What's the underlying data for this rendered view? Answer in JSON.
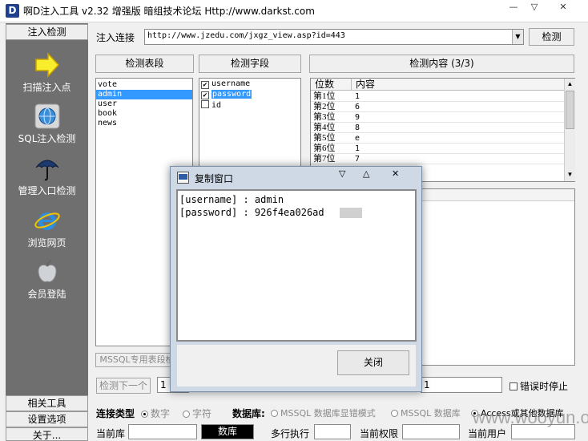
{
  "window": {
    "title": "啊D注入工具 v2.32 增强版 暗组技术论坛 Http://www.darkst.com",
    "icon_letter": "D",
    "minimize": "—",
    "restore": "▽",
    "close": "✕"
  },
  "sidebar": {
    "header": "注入检测",
    "items": [
      {
        "label": "扫描注入点",
        "icon": "arrow-icon"
      },
      {
        "label": "SQL注入检测",
        "icon": "globe-icon"
      },
      {
        "label": "管理入口检测",
        "icon": "umbrella-icon"
      },
      {
        "label": "浏览网页",
        "icon": "ie-icon"
      },
      {
        "label": "会员登陆",
        "icon": "apple-icon"
      }
    ],
    "bottom": [
      "相关工具",
      "设置选项",
      "关于..."
    ]
  },
  "toolbar": {
    "url_label": "注入连接",
    "url_value": "http://www.jzedu.com/jxgz_view.asp?id=443",
    "detect_button": "检测"
  },
  "tables_panel": {
    "button": "检测表段",
    "items": [
      "vote",
      "admin",
      "user",
      "book",
      "news"
    ],
    "selected": "admin"
  },
  "fields_panel": {
    "button": "检测字段",
    "items": [
      {
        "name": "username",
        "checked": true
      },
      {
        "name": "password",
        "checked": true
      },
      {
        "name": "id",
        "checked": false
      }
    ],
    "check_mark": "✔"
  },
  "content_panel": {
    "button": "检测内容 (3/3)",
    "col_position": "位数",
    "col_content": "内容",
    "rows": [
      {
        "pos": "第1位",
        "val": "1"
      },
      {
        "pos": "第2位",
        "val": "6"
      },
      {
        "pos": "第3位",
        "val": "9"
      },
      {
        "pos": "第4位",
        "val": "8"
      },
      {
        "pos": "第5位",
        "val": "e"
      },
      {
        "pos": "第6位",
        "val": "1"
      },
      {
        "pos": "第7位",
        "val": "7"
      }
    ]
  },
  "mssql_button": "MSSQL专用表段检",
  "next_button": "检测下一个",
  "next_value": "1",
  "right_value": "1",
  "retry_label": "错误时停止",
  "connection": {
    "type_label": "连接类型",
    "type_options": [
      "数字",
      "字符"
    ],
    "db_label": "数据库:",
    "db_options": [
      "MSSQL 数据库显错模式",
      "MSSQL 数据库",
      "Access或其他数据库"
    ]
  },
  "status": {
    "current_db": "当前库",
    "db_button": "数库",
    "multi_exec": "多行执行",
    "current_perm": "当前权限",
    "current_user": "当前用户"
  },
  "dialog": {
    "title": "复制窗口",
    "lines": [
      "[username] : admin",
      "[password] : 926f4ea026ad    9"
    ],
    "close_button": "关闭",
    "min": "▽",
    "max": "△",
    "close": "✕"
  },
  "watermark": "www.wooyun.org"
}
